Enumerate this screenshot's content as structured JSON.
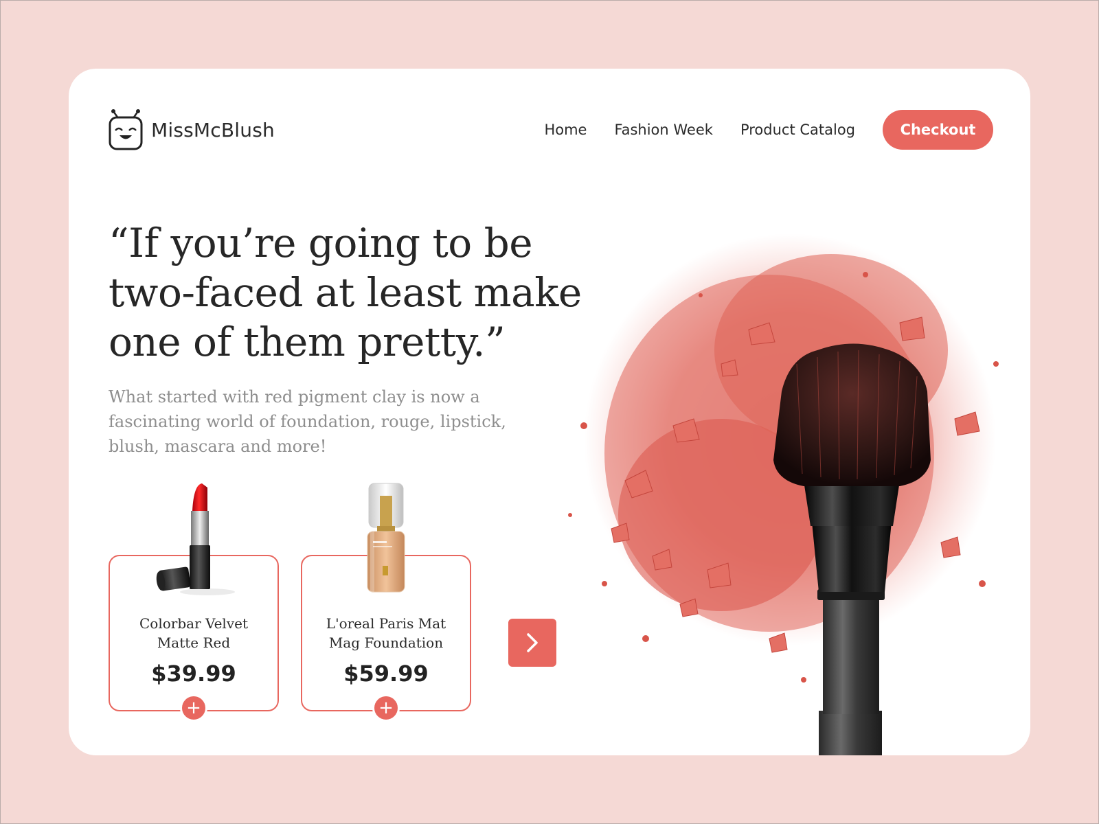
{
  "brand": {
    "name": "MissMcBlush",
    "logo_icon": "happy-face-antenna-icon"
  },
  "nav": {
    "items": [
      {
        "label": "Home"
      },
      {
        "label": "Fashion Week"
      },
      {
        "label": "Product Catalog"
      }
    ],
    "checkout_label": "Checkout"
  },
  "hero": {
    "headline": "“If you’re going to be two-faced at least make one of them pretty.”",
    "subtext": "What started with red pigment clay is now a fascinating world of foundation, rouge, lipstick, blush, mascara and more!"
  },
  "products": [
    {
      "name": "Colorbar Velvet Matte Red",
      "price": "$39.99",
      "icon": "lipstick-icon"
    },
    {
      "name": "L'oreal Paris Mat Mag Foundation",
      "price": "$59.99",
      "icon": "foundation-bottle-icon"
    }
  ],
  "controls": {
    "next_icon": "chevron-right-icon",
    "add_icon": "plus-icon"
  },
  "colors": {
    "accent": "#e8675f",
    "page_background": "#f5d9d5",
    "card_background": "#ffffff",
    "text_dark": "#2b2b2b",
    "text_muted": "#8e8e8e"
  }
}
